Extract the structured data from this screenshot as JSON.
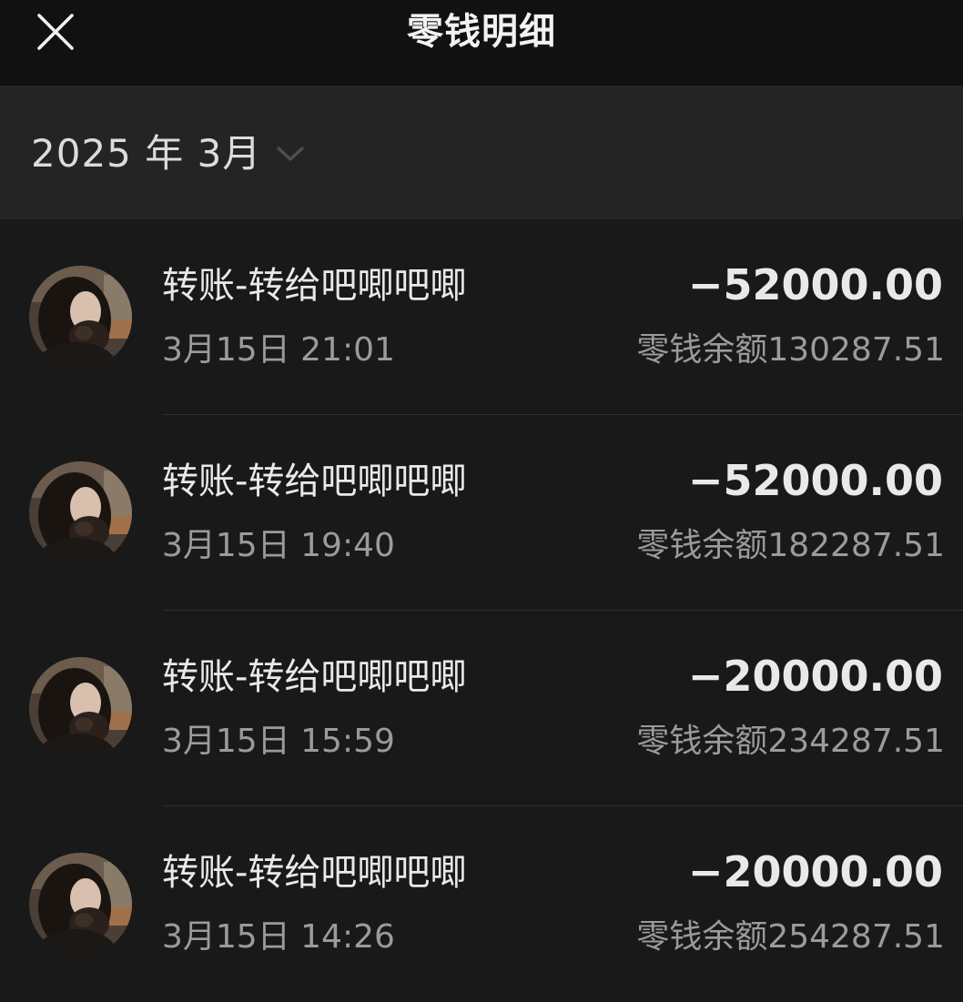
{
  "header": {
    "title": "零钱明细",
    "close_icon": "close-icon"
  },
  "filter": {
    "month_label": "2025 年 3月",
    "chevron_icon": "chevron-down-icon"
  },
  "transactions": [
    {
      "title": "转账-转给吧唧吧唧",
      "time": "3月15日 21:01",
      "amount": "−52000.00",
      "balance": "零钱余额130287.51"
    },
    {
      "title": "转账-转给吧唧吧唧",
      "time": "3月15日 19:40",
      "amount": "−52000.00",
      "balance": "零钱余额182287.51"
    },
    {
      "title": "转账-转给吧唧吧唧",
      "time": "3月15日 15:59",
      "amount": "−20000.00",
      "balance": "零钱余额234287.51"
    },
    {
      "title": "转账-转给吧唧吧唧",
      "time": "3月15日 14:26",
      "amount": "−20000.00",
      "balance": "零钱余额254287.51"
    }
  ],
  "colors": {
    "background": "#191919",
    "header": "#111111",
    "month_bar": "#242424",
    "primary_text": "#e9e9e9",
    "secondary_text": "#9b9b9b"
  }
}
